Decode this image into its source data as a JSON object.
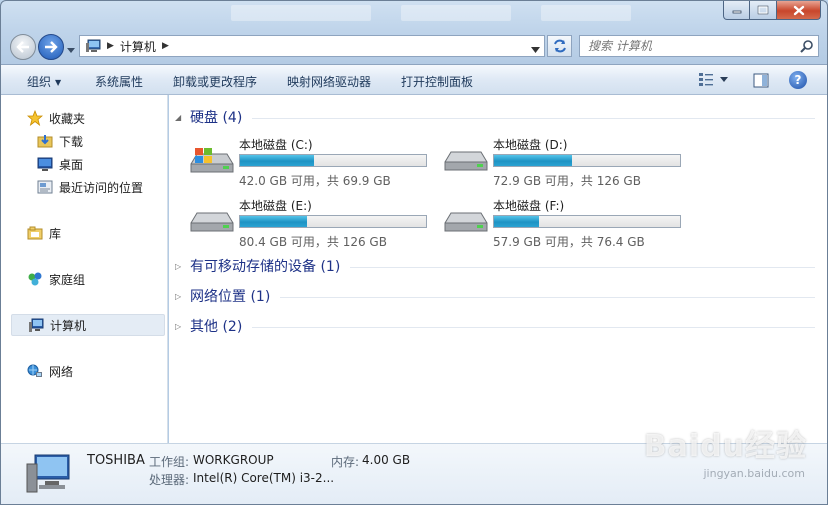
{
  "window": {
    "address_path": "计算机",
    "search_placeholder": "搜索 计算机"
  },
  "toolbar": {
    "organize": "组织",
    "system_props": "系统属性",
    "uninstall": "卸载或更改程序",
    "map_drive": "映射网络驱动器",
    "control_panel": "打开控制面板"
  },
  "sidebar": {
    "favorites": "收藏夹",
    "downloads": "下载",
    "desktop": "桌面",
    "recent": "最近访问的位置",
    "libraries": "库",
    "homegroup": "家庭组",
    "computer": "计算机",
    "network": "网络"
  },
  "groups": {
    "hard_disks": "硬盘 (4)",
    "removable": "有可移动存储的设备 (1)",
    "network_loc": "网络位置 (1)",
    "other": "其他 (2)"
  },
  "drives": [
    {
      "name": "本地磁盘 (C:)",
      "free": "42.0 GB 可用，共 69.9 GB",
      "used_fraction": 0.4
    },
    {
      "name": "本地磁盘 (D:)",
      "free": "72.9 GB 可用，共 126 GB",
      "used_fraction": 0.42
    },
    {
      "name": "本地磁盘 (E:)",
      "free": "80.4 GB 可用，共 126 GB",
      "used_fraction": 0.36
    },
    {
      "name": "本地磁盘 (F:)",
      "free": "57.9 GB 可用，共 76.4 GB",
      "used_fraction": 0.24
    }
  ],
  "details": {
    "computer_name": "TOSHIBA",
    "workgroup_label": "工作组:",
    "workgroup": "WORKGROUP",
    "memory_label": "内存:",
    "memory": "4.00 GB",
    "cpu_label": "处理器:",
    "cpu": "Intel(R) Core(TM) i3-2..."
  },
  "watermark": {
    "brand": "Baidu经验",
    "url": "jingyan.baidu.com"
  },
  "colors": {
    "bar_fill": "#1e93c4",
    "group_label": "#1e3287",
    "toolbar_text": "#1e395b"
  }
}
